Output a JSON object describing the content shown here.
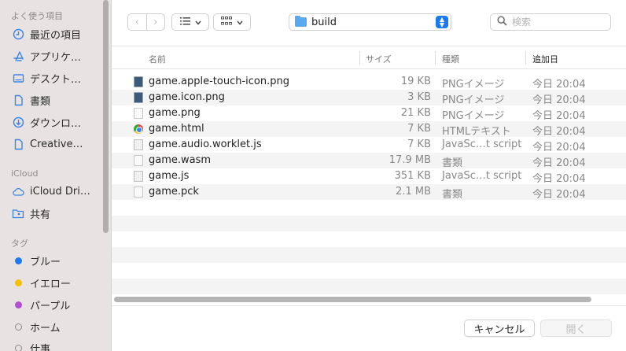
{
  "sidebar": {
    "favorites_header": "よく使う項目",
    "favorites": [
      {
        "label": "最近の項目",
        "icon": "clock-icon"
      },
      {
        "label": "アプリケ…",
        "icon": "app-store-icon"
      },
      {
        "label": "デスクト…",
        "icon": "desktop-icon"
      },
      {
        "label": "書類",
        "icon": "document-icon"
      },
      {
        "label": "ダウンロ…",
        "icon": "download-icon"
      },
      {
        "label": "Creative…",
        "icon": "file-icon"
      }
    ],
    "icloud_header": "iCloud",
    "icloud": [
      {
        "label": "iCloud Dri…",
        "icon": "cloud-icon"
      },
      {
        "label": "共有",
        "icon": "shared-folder-icon"
      }
    ],
    "tags_header": "タグ",
    "tags": [
      {
        "label": "ブルー",
        "color": "#1f7af0"
      },
      {
        "label": "イエロー",
        "color": "#f5c000"
      },
      {
        "label": "パープル",
        "color": "#b14fd1"
      },
      {
        "label": "ホーム",
        "color": ""
      },
      {
        "label": "仕事",
        "color": ""
      }
    ]
  },
  "toolbar": {
    "back_label": "‹",
    "forward_label": "›",
    "path": "build",
    "search_placeholder": "検索"
  },
  "columns": {
    "name": "名前",
    "size": "サイズ",
    "kind": "種類",
    "date": "追加日"
  },
  "files": [
    {
      "name": "game.apple-touch-icon.png",
      "size": "19 KB",
      "kind": "PNGイメージ",
      "date": "今日 20:04",
      "icon": "image-file-icon"
    },
    {
      "name": "game.icon.png",
      "size": "3 KB",
      "kind": "PNGイメージ",
      "date": "今日 20:04",
      "icon": "image-file-icon"
    },
    {
      "name": "game.png",
      "size": "21 KB",
      "kind": "PNGイメージ",
      "date": "今日 20:04",
      "icon": "image-file-icon"
    },
    {
      "name": "game.html",
      "size": "7 KB",
      "kind": "HTMLテキスト",
      "date": "今日 20:04",
      "icon": "chrome-icon"
    },
    {
      "name": "game.audio.worklet.js",
      "size": "7 KB",
      "kind": "JavaSc…t script",
      "date": "今日 20:04",
      "icon": "script-file-icon"
    },
    {
      "name": "game.wasm",
      "size": "17.9 MB",
      "kind": "書類",
      "date": "今日 20:04",
      "icon": "blank-file-icon"
    },
    {
      "name": "game.js",
      "size": "351 KB",
      "kind": "JavaSc…t script",
      "date": "今日 20:04",
      "icon": "script-file-icon"
    },
    {
      "name": "game.pck",
      "size": "2.1 MB",
      "kind": "書類",
      "date": "今日 20:04",
      "icon": "blank-file-icon"
    }
  ],
  "footer": {
    "cancel_label": "キャンセル",
    "open_label": "開く"
  }
}
